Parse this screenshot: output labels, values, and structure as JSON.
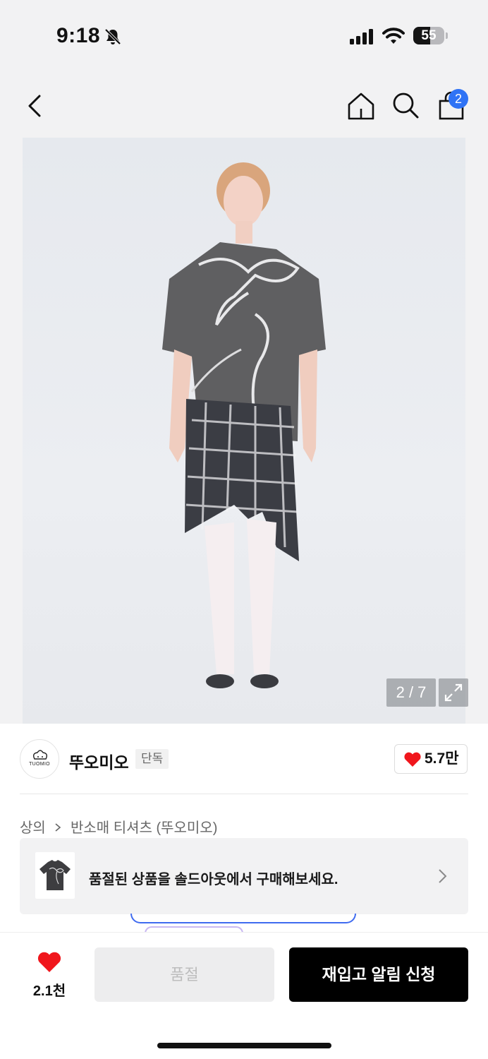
{
  "status_bar": {
    "time": "9:18",
    "battery_level": "55",
    "battery_fraction": 0.55,
    "icons": [
      "bell-slash-icon",
      "signal-icon",
      "wifi-icon",
      "battery-icon"
    ]
  },
  "nav": {
    "icons": [
      "back-chevron-icon",
      "home-icon",
      "search-icon",
      "shopping-bag-icon"
    ],
    "cart_count": "2"
  },
  "gallery": {
    "indicator": "2 / 7",
    "icons": [
      "expand-icon"
    ]
  },
  "brand": {
    "logo_text": "TUOMIO",
    "name": "뚜오미오",
    "badge": "단독",
    "likes": "5.7만"
  },
  "breadcrumb": {
    "category": "상의",
    "subcategory": "반소매 티셔츠 (뚜오미오)"
  },
  "soldout_banner": {
    "text": "품절된 상품을 솔드아웃에서 구매해보세요."
  },
  "bottom_bar": {
    "wish_count": "2.1천",
    "soldout_label": "품절",
    "restock_label": "재입고 알림 신청"
  },
  "colors": {
    "badge_blue": "#2f73f5",
    "heart_red": "#f0161c",
    "primary_black": "#000000",
    "disabled_gray": "#ededee"
  }
}
